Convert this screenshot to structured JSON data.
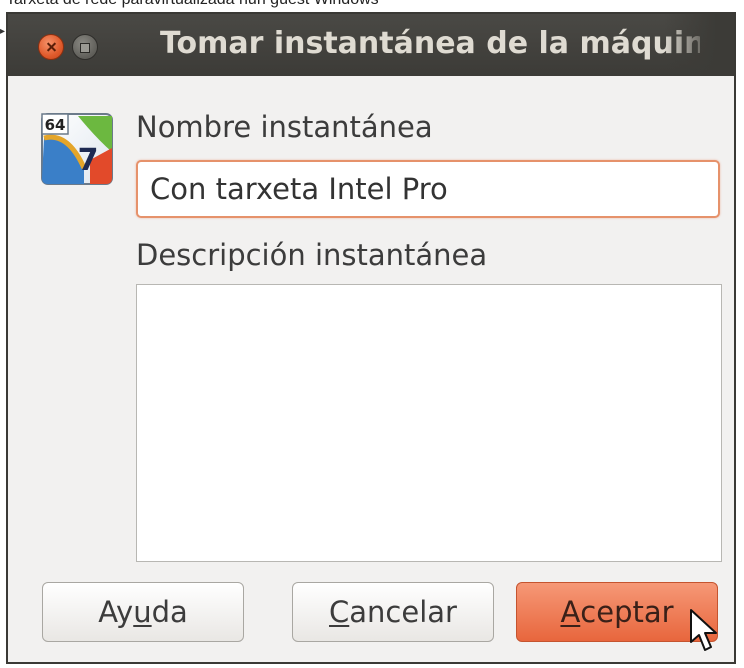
{
  "caption": "Tarxeta de rede paravirtualizada nun guest Windows",
  "dialog": {
    "title": "Tomar instantánea de la máquina",
    "icon": "virtualbox-snapshot-icon",
    "icon_badge": "64",
    "icon_numeral": "7"
  },
  "form": {
    "name_label": "Nombre instantánea",
    "name_value": "Con tarxeta Intel Pro",
    "description_label": "Descripción instantánea",
    "description_value": ""
  },
  "buttons": {
    "help": {
      "before": "Ay",
      "mnemonic": "u",
      "after": "da"
    },
    "cancel": {
      "before": "",
      "mnemonic": "C",
      "after": "ancelar"
    },
    "ok": {
      "before": "",
      "mnemonic": "A",
      "after": "ceptar"
    }
  },
  "colors": {
    "titlebar": "#3c3b37",
    "accent": "#e9643a",
    "focus_border": "#e6926b",
    "dialog_bg": "#f2f1f0"
  }
}
